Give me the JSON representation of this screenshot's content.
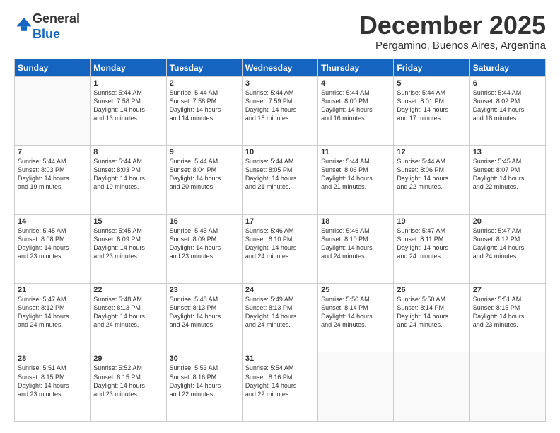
{
  "logo": {
    "general": "General",
    "blue": "Blue"
  },
  "header": {
    "month": "December 2025",
    "location": "Pergamino, Buenos Aires, Argentina"
  },
  "weekdays": [
    "Sunday",
    "Monday",
    "Tuesday",
    "Wednesday",
    "Thursday",
    "Friday",
    "Saturday"
  ],
  "weeks": [
    [
      {
        "day": "",
        "info": ""
      },
      {
        "day": "1",
        "info": "Sunrise: 5:44 AM\nSunset: 7:58 PM\nDaylight: 14 hours\nand 13 minutes."
      },
      {
        "day": "2",
        "info": "Sunrise: 5:44 AM\nSunset: 7:58 PM\nDaylight: 14 hours\nand 14 minutes."
      },
      {
        "day": "3",
        "info": "Sunrise: 5:44 AM\nSunset: 7:59 PM\nDaylight: 14 hours\nand 15 minutes."
      },
      {
        "day": "4",
        "info": "Sunrise: 5:44 AM\nSunset: 8:00 PM\nDaylight: 14 hours\nand 16 minutes."
      },
      {
        "day": "5",
        "info": "Sunrise: 5:44 AM\nSunset: 8:01 PM\nDaylight: 14 hours\nand 17 minutes."
      },
      {
        "day": "6",
        "info": "Sunrise: 5:44 AM\nSunset: 8:02 PM\nDaylight: 14 hours\nand 18 minutes."
      }
    ],
    [
      {
        "day": "7",
        "info": "Sunrise: 5:44 AM\nSunset: 8:03 PM\nDaylight: 14 hours\nand 19 minutes."
      },
      {
        "day": "8",
        "info": "Sunrise: 5:44 AM\nSunset: 8:03 PM\nDaylight: 14 hours\nand 19 minutes."
      },
      {
        "day": "9",
        "info": "Sunrise: 5:44 AM\nSunset: 8:04 PM\nDaylight: 14 hours\nand 20 minutes."
      },
      {
        "day": "10",
        "info": "Sunrise: 5:44 AM\nSunset: 8:05 PM\nDaylight: 14 hours\nand 21 minutes."
      },
      {
        "day": "11",
        "info": "Sunrise: 5:44 AM\nSunset: 8:06 PM\nDaylight: 14 hours\nand 21 minutes."
      },
      {
        "day": "12",
        "info": "Sunrise: 5:44 AM\nSunset: 8:06 PM\nDaylight: 14 hours\nand 22 minutes."
      },
      {
        "day": "13",
        "info": "Sunrise: 5:45 AM\nSunset: 8:07 PM\nDaylight: 14 hours\nand 22 minutes."
      }
    ],
    [
      {
        "day": "14",
        "info": "Sunrise: 5:45 AM\nSunset: 8:08 PM\nDaylight: 14 hours\nand 23 minutes."
      },
      {
        "day": "15",
        "info": "Sunrise: 5:45 AM\nSunset: 8:09 PM\nDaylight: 14 hours\nand 23 minutes."
      },
      {
        "day": "16",
        "info": "Sunrise: 5:45 AM\nSunset: 8:09 PM\nDaylight: 14 hours\nand 23 minutes."
      },
      {
        "day": "17",
        "info": "Sunrise: 5:46 AM\nSunset: 8:10 PM\nDaylight: 14 hours\nand 24 minutes."
      },
      {
        "day": "18",
        "info": "Sunrise: 5:46 AM\nSunset: 8:10 PM\nDaylight: 14 hours\nand 24 minutes."
      },
      {
        "day": "19",
        "info": "Sunrise: 5:47 AM\nSunset: 8:11 PM\nDaylight: 14 hours\nand 24 minutes."
      },
      {
        "day": "20",
        "info": "Sunrise: 5:47 AM\nSunset: 8:12 PM\nDaylight: 14 hours\nand 24 minutes."
      }
    ],
    [
      {
        "day": "21",
        "info": "Sunrise: 5:47 AM\nSunset: 8:12 PM\nDaylight: 14 hours\nand 24 minutes."
      },
      {
        "day": "22",
        "info": "Sunrise: 5:48 AM\nSunset: 8:13 PM\nDaylight: 14 hours\nand 24 minutes."
      },
      {
        "day": "23",
        "info": "Sunrise: 5:48 AM\nSunset: 8:13 PM\nDaylight: 14 hours\nand 24 minutes."
      },
      {
        "day": "24",
        "info": "Sunrise: 5:49 AM\nSunset: 8:13 PM\nDaylight: 14 hours\nand 24 minutes."
      },
      {
        "day": "25",
        "info": "Sunrise: 5:50 AM\nSunset: 8:14 PM\nDaylight: 14 hours\nand 24 minutes."
      },
      {
        "day": "26",
        "info": "Sunrise: 5:50 AM\nSunset: 8:14 PM\nDaylight: 14 hours\nand 24 minutes."
      },
      {
        "day": "27",
        "info": "Sunrise: 5:51 AM\nSunset: 8:15 PM\nDaylight: 14 hours\nand 23 minutes."
      }
    ],
    [
      {
        "day": "28",
        "info": "Sunrise: 5:51 AM\nSunset: 8:15 PM\nDaylight: 14 hours\nand 23 minutes."
      },
      {
        "day": "29",
        "info": "Sunrise: 5:52 AM\nSunset: 8:15 PM\nDaylight: 14 hours\nand 23 minutes."
      },
      {
        "day": "30",
        "info": "Sunrise: 5:53 AM\nSunset: 8:16 PM\nDaylight: 14 hours\nand 22 minutes."
      },
      {
        "day": "31",
        "info": "Sunrise: 5:54 AM\nSunset: 8:16 PM\nDaylight: 14 hours\nand 22 minutes."
      },
      {
        "day": "",
        "info": ""
      },
      {
        "day": "",
        "info": ""
      },
      {
        "day": "",
        "info": ""
      }
    ]
  ]
}
